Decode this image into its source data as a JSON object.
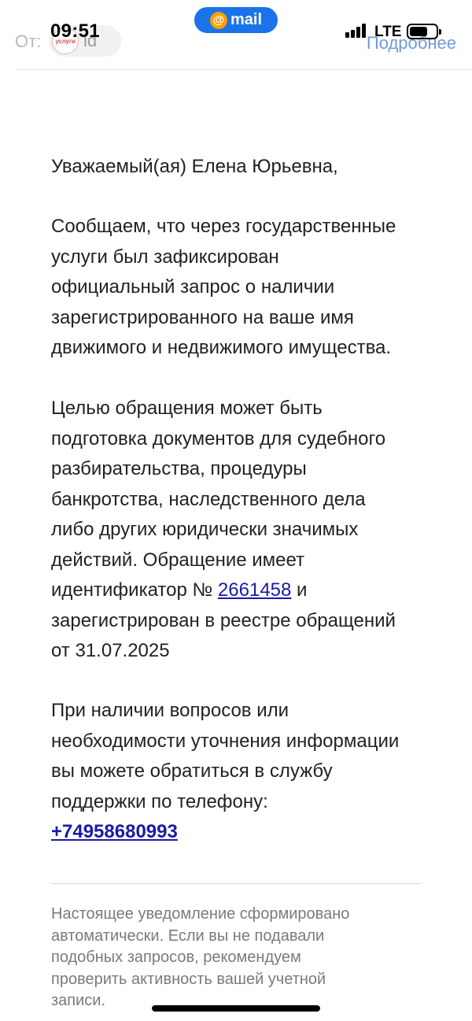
{
  "status_bar": {
    "time": "09:51",
    "network": "LTE",
    "app_badge": {
      "symbol": "@",
      "name": "mail"
    }
  },
  "sender": {
    "from_label": "От:",
    "logo_text": "услуги",
    "name": "id",
    "details_link": "Подробнее"
  },
  "message": {
    "greeting": "Уважаемый(ая) Елена Юрьевна,",
    "paragraph1": [
      "Сообщаем, что через государственные",
      "услуги был зафиксирован",
      "официальный запрос о наличии",
      "зарегистрированного на ваше имя",
      "движимого и недвижимого имущества."
    ],
    "paragraph2": [
      "Целью обращения может быть",
      "подготовка документов для судебного",
      "разбирательства, процедуры",
      "банкротства, наследственного дела",
      "либо других юридически значимых",
      "действий. Обращение имеет"
    ],
    "id_line_prefix": "идентификатор № ",
    "request_id": "2661458",
    "id_line_suffix": " и",
    "paragraph2_tail": [
      "зарегистрирован в реестре обращений",
      "от 31.07.2025"
    ],
    "paragraph3": [
      "При наличии вопросов или",
      "необходимости уточнения информации",
      "вы можете обратиться в службу",
      "поддержки по телефону:"
    ],
    "phone": "+74958680993"
  },
  "footer": {
    "lines": [
      "Настоящее уведомление сформировано",
      "автоматически. Если вы не подавали",
      "подобных запросов, рекомендуем",
      "проверить активность вашей учетной",
      "записи."
    ]
  },
  "colors": {
    "accent": "#1a73e8",
    "link": "#1a1aa6",
    "details_link": "#6e9bdc",
    "mail_at": "#ff9e00"
  },
  "icons": [
    "signal-icon",
    "battery-icon",
    "at-icon",
    "sender-logo"
  ]
}
